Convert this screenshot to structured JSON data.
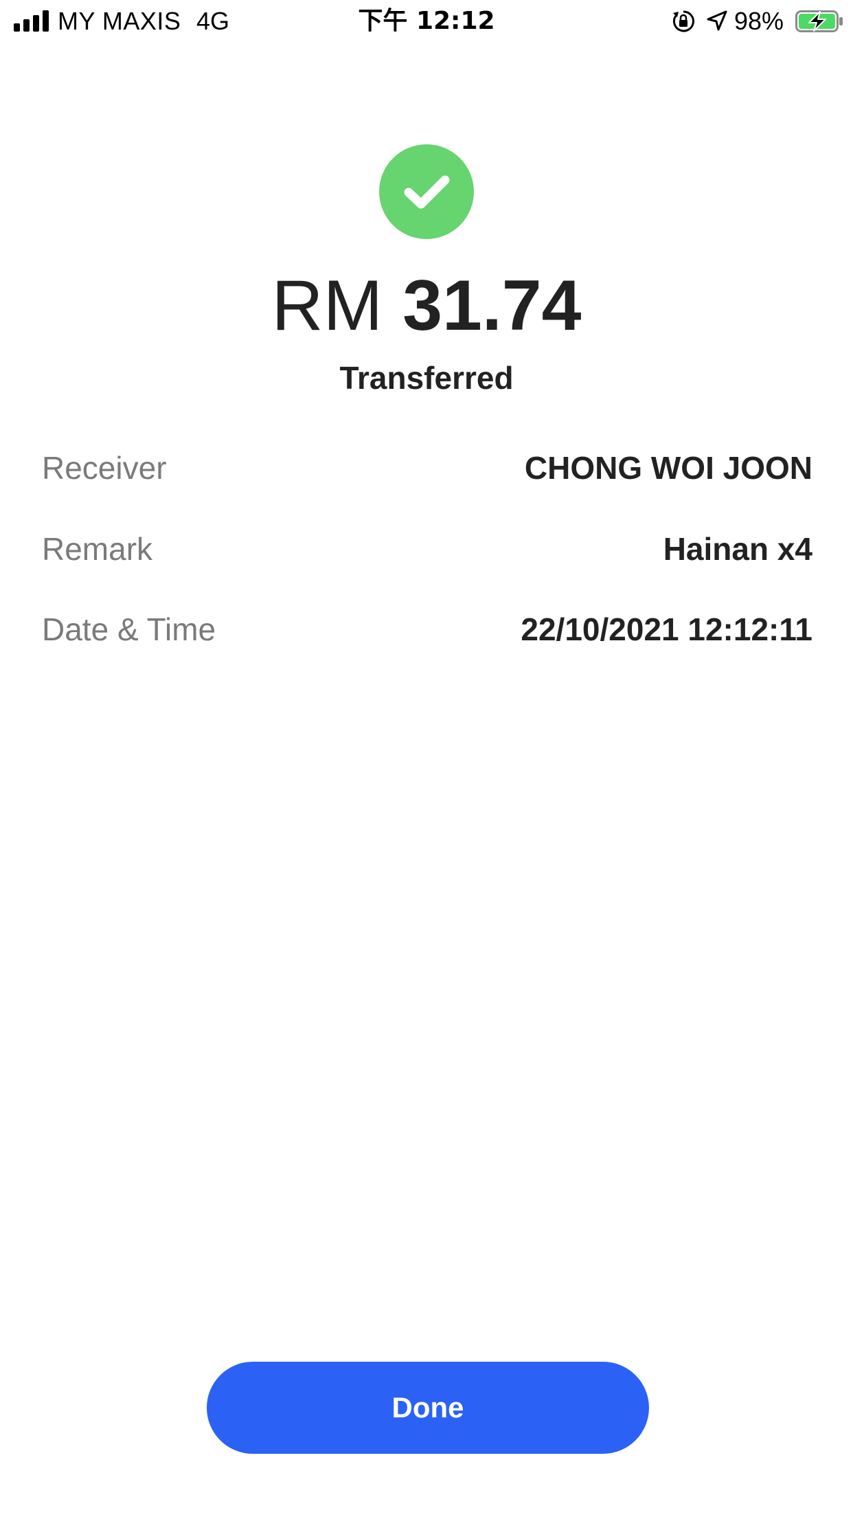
{
  "status_bar": {
    "carrier": "MY MAXIS",
    "network": "4G",
    "time": "下午 12:12",
    "battery_percent": "98%",
    "battery_level": 0.98,
    "battery_charging": true,
    "battery_color": "#4cd964",
    "icons": [
      "signal-bars-icon",
      "rotation-lock-icon",
      "location-arrow-icon",
      "battery-charging-icon"
    ]
  },
  "receipt": {
    "success_icon": "checkmark-icon",
    "success_color": "#66d46f",
    "currency": "RM",
    "amount": "31.74",
    "status": "Transferred",
    "details": [
      {
        "label": "Receiver",
        "value": "CHONG WOI JOON"
      },
      {
        "label": "Remark",
        "value": "Hainan x4"
      },
      {
        "label": "Date & Time",
        "value": "22/10/2021 12:12:11"
      }
    ]
  },
  "actions": {
    "done_label": "Done",
    "done_color": "#2b62f5"
  }
}
